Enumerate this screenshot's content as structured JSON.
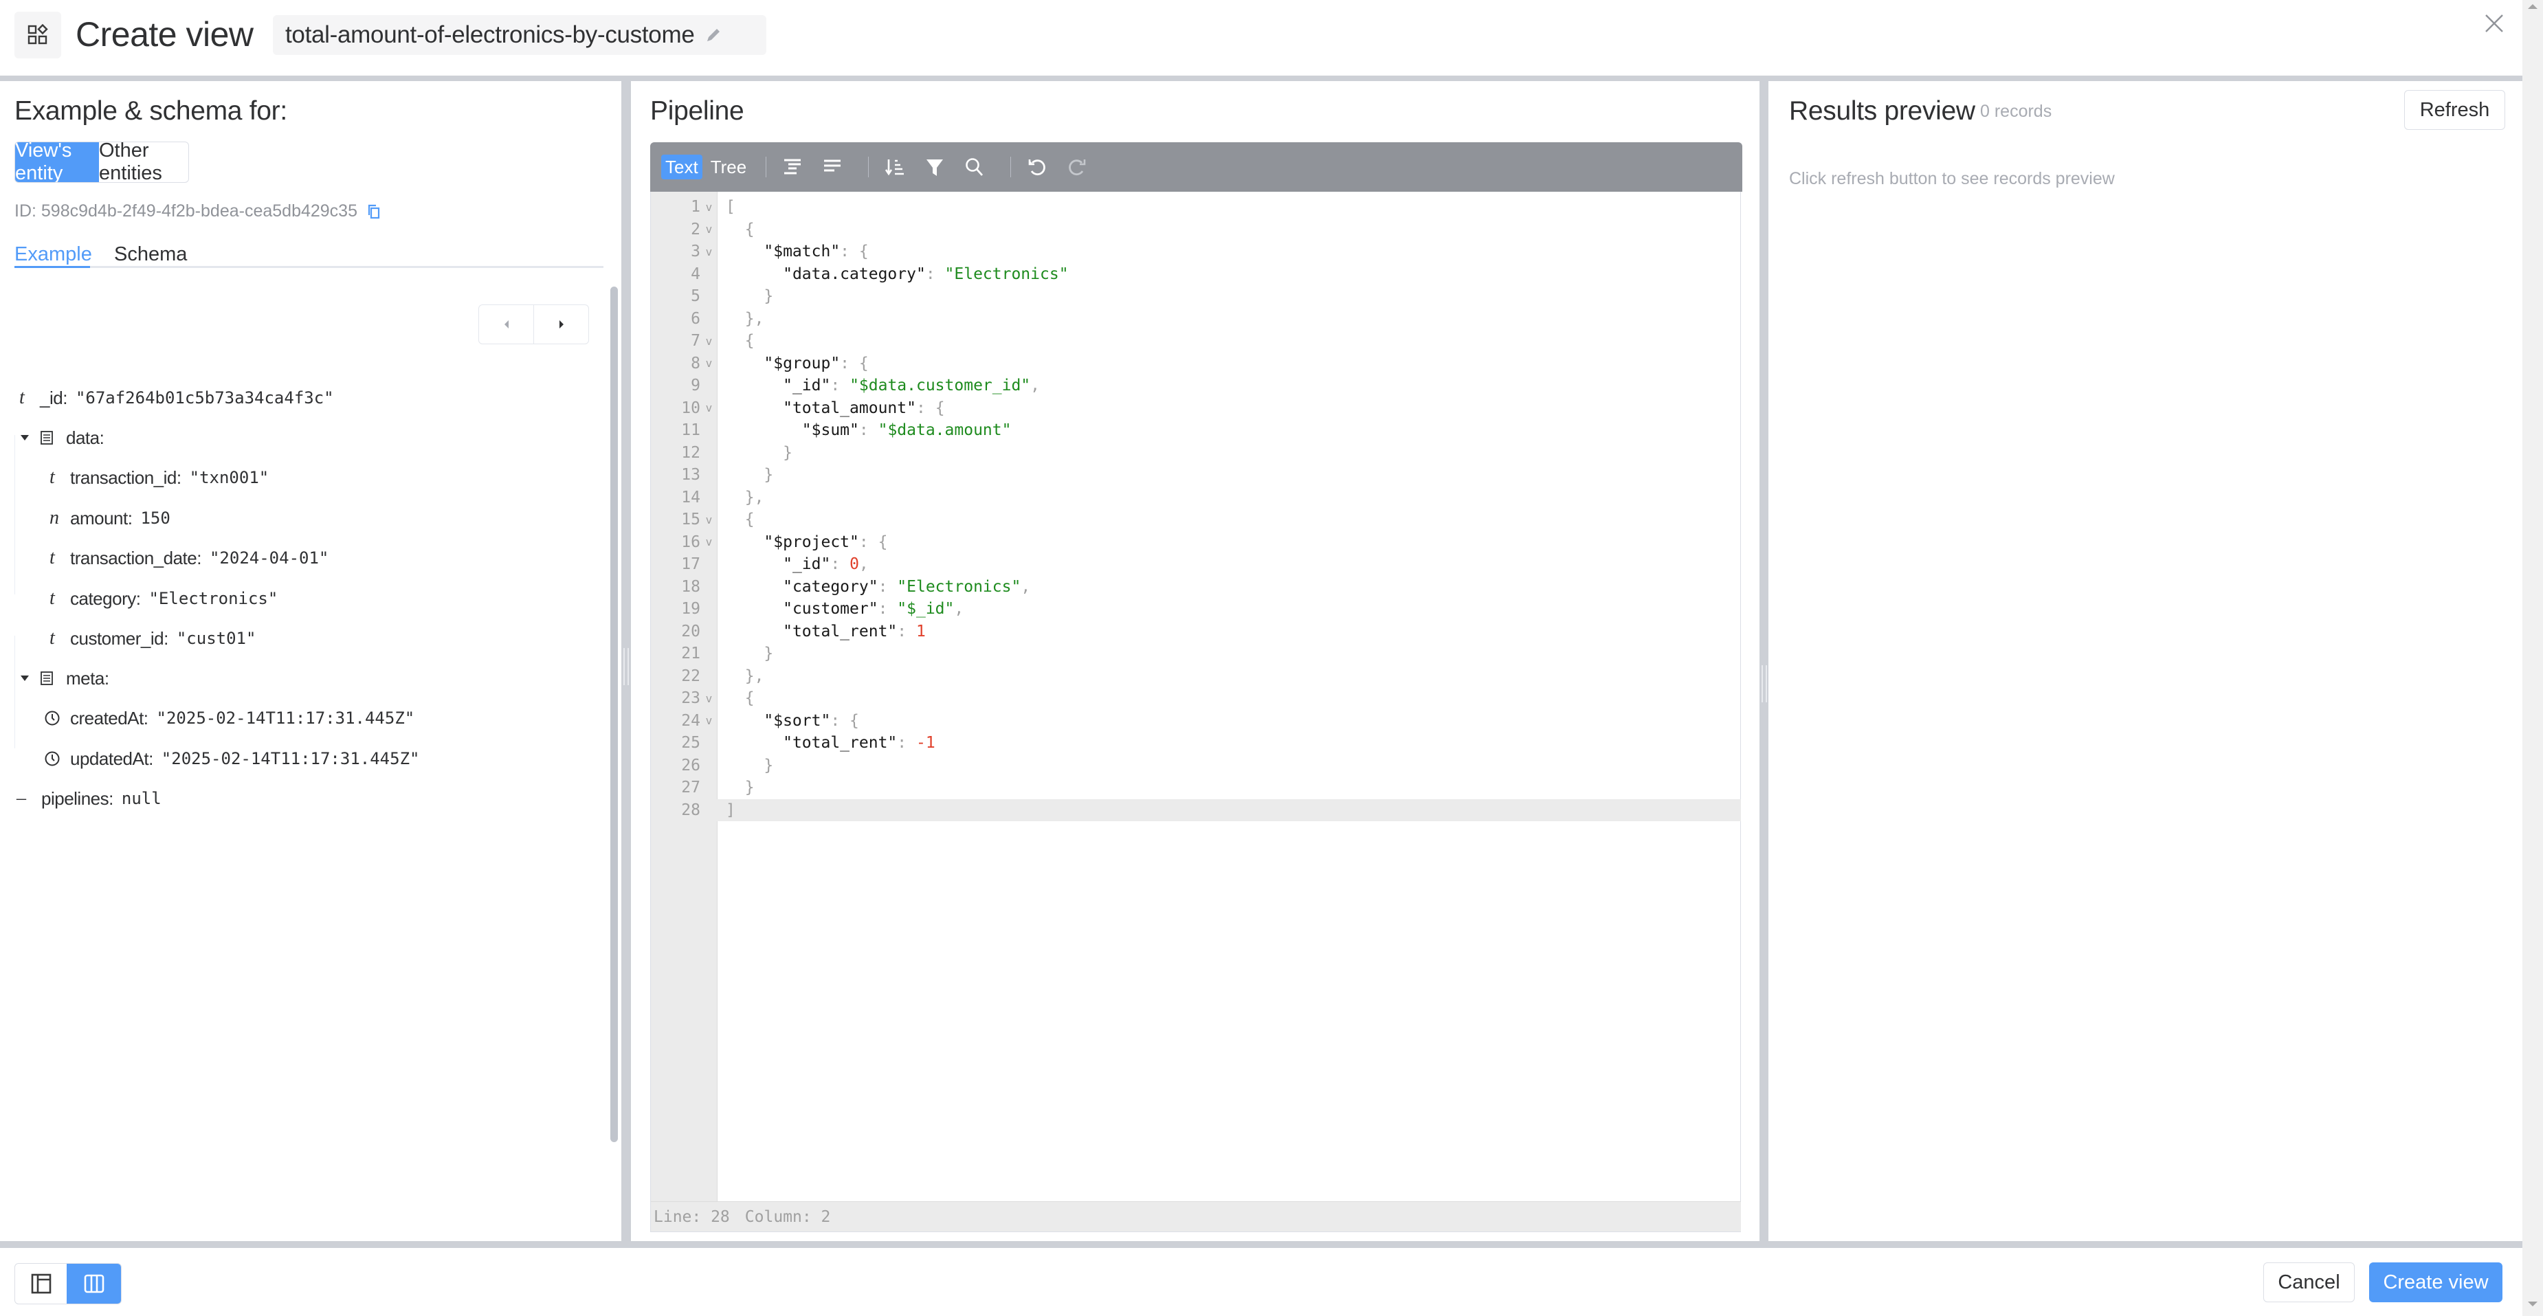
{
  "header": {
    "app_icon": "widgets-icon",
    "title": "Create view",
    "view_name": "total-amount-of-electronics-by-custome",
    "edit_icon": "pencil-icon",
    "close_icon": "close-icon"
  },
  "left_panel": {
    "title": "Example & schema for:",
    "entity_switch": {
      "options": [
        "View's entity",
        "Other entities"
      ],
      "selected": "View's entity"
    },
    "id_label": "ID: 598c9d4b-2f49-4f2b-bdea-cea5db429c35",
    "copy_icon": "copy-icon",
    "tabs": [
      {
        "label": "Example",
        "active": true
      },
      {
        "label": "Schema",
        "active": false
      }
    ],
    "pager": {
      "prev_icon": "caret-left-icon",
      "next_icon": "caret-right-icon"
    },
    "tree": [
      {
        "type": "t",
        "key": "_id",
        "value": "\"67af264b01c5b73a34ca4f3c\"",
        "level": 0
      },
      {
        "type": "object",
        "key": "data",
        "value": "",
        "level": 0,
        "expanded": true
      },
      {
        "type": "t",
        "key": "transaction_id",
        "value": "\"txn001\"",
        "level": 1
      },
      {
        "type": "n",
        "key": "amount",
        "value": "150",
        "level": 1
      },
      {
        "type": "t",
        "key": "transaction_date",
        "value": "\"2024-04-01\"",
        "level": 1
      },
      {
        "type": "t",
        "key": "category",
        "value": "\"Electronics\"",
        "level": 1
      },
      {
        "type": "t",
        "key": "customer_id",
        "value": "\"cust01\"",
        "level": 1
      },
      {
        "type": "object",
        "key": "meta",
        "value": "",
        "level": 0,
        "expanded": true
      },
      {
        "type": "date",
        "key": "createdAt",
        "value": "\"2025-02-14T11:17:31.445Z\"",
        "level": 1
      },
      {
        "type": "date",
        "key": "updatedAt",
        "value": "\"2025-02-14T11:17:31.445Z\"",
        "level": 1
      },
      {
        "type": "null",
        "key": "pipelines",
        "value": "null",
        "level": 0
      }
    ]
  },
  "pipeline_panel": {
    "title": "Pipeline",
    "toolbar": {
      "modes": [
        {
          "label": "Text",
          "active": true
        },
        {
          "label": "Tree",
          "active": false
        }
      ],
      "buttons": [
        "format-icon",
        "compact-icon",
        "sort-icon",
        "filter-icon",
        "search-icon",
        "undo-icon",
        "redo-icon"
      ]
    },
    "code_lines": [
      "[",
      "  {",
      "    \"$match\": {",
      "      \"data.category\": \"Electronics\"",
      "    }",
      "  },",
      "  {",
      "    \"$group\": {",
      "      \"_id\": \"$data.customer_id\",",
      "      \"total_amount\": {",
      "        \"$sum\": \"$data.amount\"",
      "      }",
      "    }",
      "  },",
      "  {",
      "    \"$project\": {",
      "      \"_id\": 0,",
      "      \"category\": \"Electronics\",",
      "      \"customer\": \"$_id\",",
      "      \"total_rent\": 1",
      "    }",
      "  },",
      "  {",
      "    \"$sort\": {",
      "      \"total_rent\": -1",
      "    }",
      "  }",
      "]"
    ],
    "foldable_lines": [
      1,
      2,
      3,
      7,
      8,
      10,
      15,
      16,
      23,
      24
    ],
    "active_line": 28,
    "status": {
      "line_label": "Line: 28",
      "column_label": "Column: 2"
    }
  },
  "results_panel": {
    "title": "Results preview",
    "record_count": "0 records",
    "refresh_label": "Refresh",
    "hint": "Click refresh button to see records preview"
  },
  "footer": {
    "layout_options": [
      {
        "icon": "layout-sidebar-icon",
        "active": false
      },
      {
        "icon": "layout-columns-icon",
        "active": true
      }
    ],
    "cancel_label": "Cancel",
    "create_label": "Create view"
  },
  "colors": {
    "accent": "#529bf8",
    "toolbar": "#909399",
    "string": "#1e8b1e",
    "number": "#e0402b"
  }
}
